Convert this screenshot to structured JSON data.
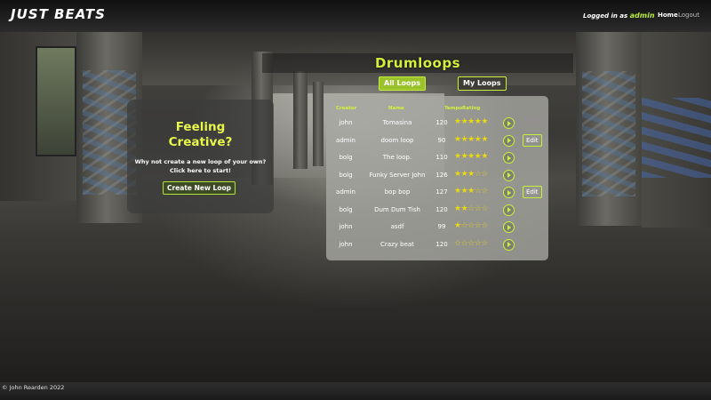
{
  "brand": "JUST BEATS",
  "nav": {
    "logged_in_prefix": "Logged in as",
    "username": "admin",
    "home": "Home",
    "logout": "Logout"
  },
  "page": {
    "title": "Drumloops",
    "tabs": [
      "All Loops",
      "My Loops"
    ]
  },
  "creative": {
    "heading_line1": "Feeling",
    "heading_line2": "Creative?",
    "text_line1": "Why not create a new loop of your own?",
    "text_line2": "Click here to start!",
    "button": "Create New Loop"
  },
  "table": {
    "headers": [
      "Creator",
      "Name",
      "Tempo",
      "Rating"
    ],
    "rows": [
      {
        "creator": "john",
        "name": "Tomasina",
        "tempo": "120",
        "rating": 5,
        "edit": ""
      },
      {
        "creator": "admin",
        "name": "doom loop",
        "tempo": "90",
        "rating": 5,
        "edit": "Edit"
      },
      {
        "creator": "bolg",
        "name": "The loop.",
        "tempo": "110",
        "rating": 5,
        "edit": ""
      },
      {
        "creator": "bolg",
        "name": "Funky Server John",
        "tempo": "126",
        "rating": 3,
        "edit": ""
      },
      {
        "creator": "admin",
        "name": "bop bop",
        "tempo": "127",
        "rating": 3,
        "edit": "Edit"
      },
      {
        "creator": "bolg",
        "name": "Dum Dum Tish",
        "tempo": "120",
        "rating": 2,
        "edit": ""
      },
      {
        "creator": "john",
        "name": "asdf",
        "tempo": "99",
        "rating": 1,
        "edit": ""
      },
      {
        "creator": "john",
        "name": "Crazy beat",
        "tempo": "120",
        "rating": 0,
        "edit": ""
      }
    ]
  },
  "footer": "© John Rearden 2022",
  "colors": {
    "accent": "#c6ef3a",
    "star": "#e8d80f"
  },
  "icons": {
    "play": "play-circle-icon",
    "star": "star-icon"
  }
}
